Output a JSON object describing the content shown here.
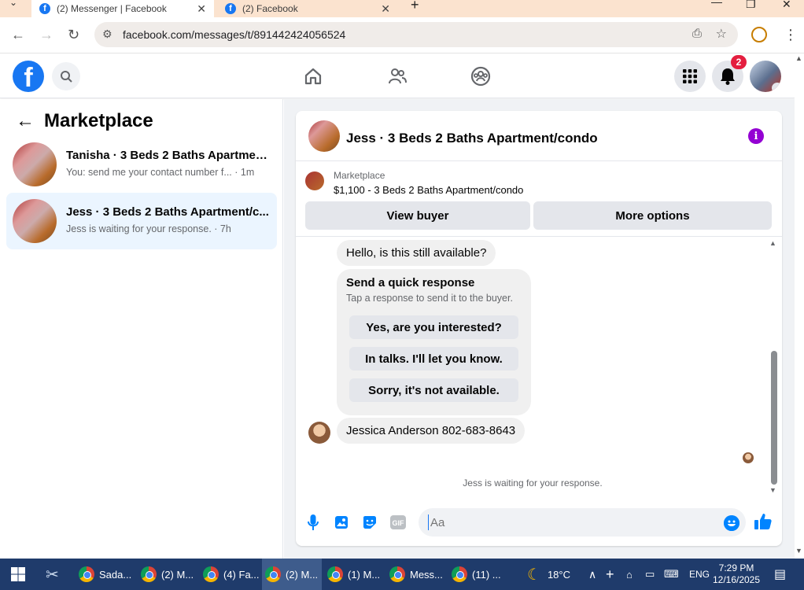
{
  "browser": {
    "tabs": [
      {
        "title": "(2) Messenger | Facebook",
        "active": true
      },
      {
        "title": "(2) Facebook",
        "active": false
      }
    ],
    "url": "facebook.com/messages/t/891442424056524"
  },
  "header": {
    "notification_count": "2"
  },
  "sidebar": {
    "title": "Marketplace",
    "conversations": [
      {
        "name": "Tanisha · 3 Beds 2 Baths Apartmen...",
        "preview": "You: send me your contact number f... · 1m",
        "selected": false
      },
      {
        "name": "Jess · 3 Beds 2 Baths Apartment/c...",
        "preview": "Jess is waiting for your response. · 7h",
        "selected": true
      }
    ]
  },
  "chat": {
    "title": "Jess · 3 Beds 2 Baths Apartment/condo",
    "listing": {
      "label": "Marketplace",
      "price_title": "$1,100 - 3 Beds 2 Baths Apartment/condo"
    },
    "buttons": {
      "view_buyer": "View buyer",
      "more_options": "More options"
    },
    "messages": {
      "first": "Hello, is this still available?",
      "quick_title": "Send a quick response",
      "quick_sub": "Tap a response to send it to the buyer.",
      "quick_replies": [
        "Yes, are you interested?",
        "In talks. I'll let you know.",
        "Sorry, it's not available."
      ],
      "contact": "Jessica Anderson 802-683-8643"
    },
    "waiting": "Jess is waiting for your response.",
    "composer_placeholder": "Aa"
  },
  "taskbar": {
    "items": [
      "Sada...",
      "(2) M...",
      "(4) Fa...",
      "(2) M...",
      "(1) M...",
      "Mess...",
      "(11) ..."
    ],
    "weather": "18°C",
    "language": "ENG",
    "time": "7:29 PM",
    "date": "12/16/2025"
  },
  "colors": {
    "fb_blue": "#1877f2",
    "selected_conv": "#ebf5ff",
    "badge_red": "#e41e3f",
    "info_purple": "#9400d3",
    "taskbar": "#1f3b6b"
  }
}
